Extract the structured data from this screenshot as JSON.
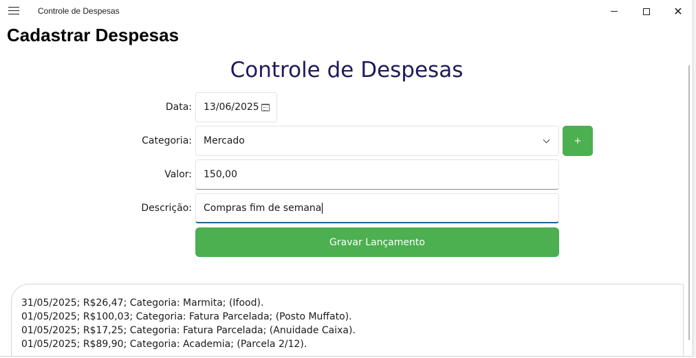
{
  "window": {
    "title": "Controle de Despesas",
    "minimize_icon": "minimize-icon",
    "maximize_icon": "maximize-icon",
    "close_icon": "close-icon",
    "close_glyph": "✕"
  },
  "page": {
    "title": "Cadastrar Despesas",
    "heading": "Controle de Despesas"
  },
  "form": {
    "date_label": "Data:",
    "date_value": "13/06/2025",
    "category_label": "Categoria:",
    "category_value": "Mercado",
    "add_category_label": "+",
    "value_label": "Valor:",
    "value_value": "150,00",
    "description_label": "Descrição:",
    "description_value": "Compras fim de semana",
    "save_label": "Gravar Lançamento"
  },
  "entries": [
    "31/05/2025; R$26,47; Categoria: Marmita; (Ifood).",
    "01/05/2025; R$100,03; Categoria: Fatura Parcelada; (Posto Muffato).",
    "01/05/2025; R$17,25; Categoria: Fatura Parcelada; (Anuidade Caixa).",
    "01/05/2025; R$89,90; Categoria: Academia; (Parcela 2/12)."
  ],
  "colors": {
    "accent_green": "#4caf50",
    "heading_color": "#1f1a5c",
    "focus_underline": "#1f5e8c"
  }
}
